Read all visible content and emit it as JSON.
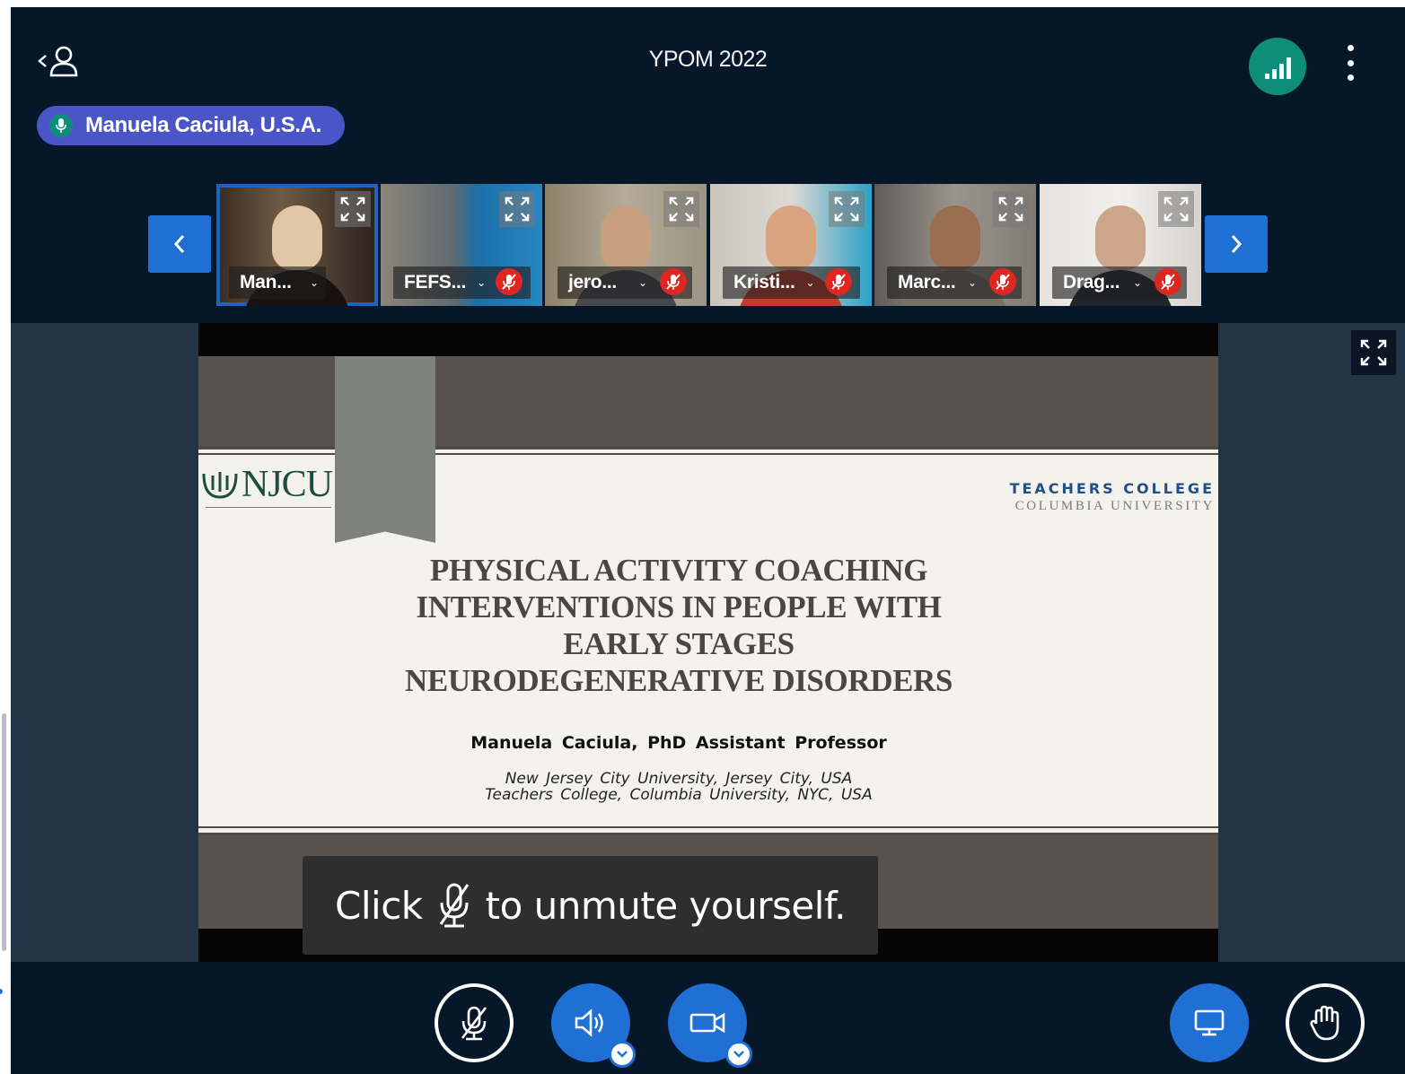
{
  "header": {
    "title": "YPOM 2022",
    "back_icon": "chevron-left-icon",
    "user_icon": "user-icon",
    "connection_icon": "signal-bars-icon",
    "more_icon": "more-vertical-icon"
  },
  "talking": {
    "name": "Manuela Caciula, U.S.A.",
    "icon": "microphone-icon"
  },
  "participants": [
    {
      "label": "Man...",
      "muted": false,
      "active": true
    },
    {
      "label": "FEFS...",
      "muted": true,
      "active": false
    },
    {
      "label": "jero...",
      "muted": true,
      "active": false
    },
    {
      "label": "Kristi...",
      "muted": true,
      "active": false
    },
    {
      "label": "Marc...",
      "muted": true,
      "active": false
    },
    {
      "label": "Drag...",
      "muted": true,
      "active": false
    }
  ],
  "slide": {
    "logo_left": "NJCU",
    "logo_right_line1": "TEACHERS COLLEGE",
    "logo_right_line2": "COLUMBIA UNIVERSITY",
    "title_lines": [
      "PHYSICAL ACTIVITY COACHING",
      "INTERVENTIONS IN PEOPLE WITH",
      "EARLY STAGES",
      "NEURODEGENERATIVE DISORDERS"
    ],
    "author": "Manuela Caciula, PhD Assistant Professor",
    "affiliation_line1": "New Jersey City University, Jersey City, USA",
    "affiliation_line2": "Teachers College, Columbia University, NYC, USA"
  },
  "toast": {
    "before": "Click",
    "after": "to unmute yourself."
  },
  "controls": {
    "mic_icon": "microphone-muted-icon",
    "audio_icon": "speaker-icon",
    "video_icon": "video-camera-icon",
    "share_icon": "screen-share-icon",
    "hand_icon": "raise-hand-icon"
  },
  "colors": {
    "background": "#06172a",
    "accent_blue": "#1f6fd5",
    "connection_green": "#0f8d7b",
    "talker_purple": "#4a55c7",
    "muted_red": "#df2721"
  }
}
